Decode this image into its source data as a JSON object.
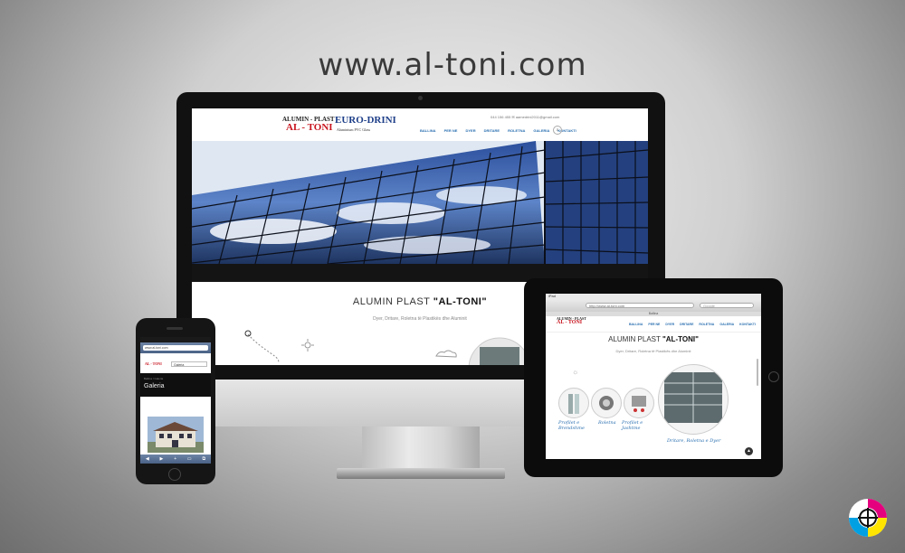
{
  "headline": "www.al-toni.com",
  "desktop": {
    "logo_left_line1": "ALUMIN - PLAST",
    "logo_left_line2": "AL - TONI",
    "logo_right_line1": "EURO-DRINI",
    "logo_right_line2": "Aluminium PVC Glass",
    "contact": "044 156 455   ✉ aamedrini2011@gmail.com",
    "nav": [
      "BALLINA",
      "PER NE",
      "DYER",
      "DRITARE",
      "ROLETNA",
      "GALERIA",
      "KONTAKTI"
    ],
    "intro_title_prefix": "ALUMIN PLAST ",
    "intro_title_bold": "\"AL-TONI\"",
    "intro_subtitle": "Dyer, Dritare, Roletna të Plastikës dhe Aluminit"
  },
  "tablet": {
    "status_left": "iPad",
    "url": "http://www.al-toni.com",
    "search_placeholder": "Google",
    "tab_title": "Ballina",
    "logo_line1": "ALUMIN - PLAST",
    "logo_line2": "AL - TONI",
    "nav": [
      "BALLINA",
      "PER NE",
      "DYER",
      "DRITARE",
      "ROLETNA",
      "GALERIA",
      "KONTAKTI"
    ],
    "title_prefix": "ALUMIN PLAST ",
    "title_bold": "\"AL-TONI\"",
    "subtitle": "Dyer, Dritare, Roletna të Plastikës dhe Aluminit",
    "captions": [
      "Profilet e Brendshme",
      "Roletna",
      "Profilet e Jashtme",
      "Dritare, Roletna e Dyer"
    ]
  },
  "phone": {
    "url": "www.al-toni.com",
    "logo": "AL - TONI",
    "select_value": "Galeria",
    "breadcrumb": "Ballina  /  Galeria",
    "page_title": "Galeria",
    "toolbar_icons": [
      "◀",
      "▶",
      "+",
      "▭",
      "⧉"
    ]
  },
  "colors": {
    "brand_red": "#c8141e",
    "brand_blue": "#1d3e88",
    "nav_blue": "#2a6fb0"
  }
}
